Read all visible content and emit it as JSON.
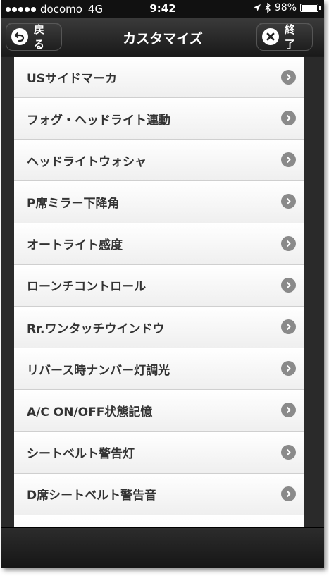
{
  "status_bar": {
    "carrier": "docomo",
    "network": "4G",
    "time": "9:42",
    "battery": "98%",
    "battery_level": 0.98
  },
  "nav": {
    "title": "カスタマイズ",
    "back_label": "戻る",
    "done_label": "終了"
  },
  "list": {
    "items": [
      {
        "label": "USサイドマーカ"
      },
      {
        "label": "フォグ・ヘッドライト連動"
      },
      {
        "label": "ヘッドライトウォシャ"
      },
      {
        "label": "P席ミラー下降角"
      },
      {
        "label": "オートライト感度"
      },
      {
        "label": "ローンチコントロール"
      },
      {
        "label": "Rr.ワンタッチウインドウ"
      },
      {
        "label": "リバース時ナンバー灯調光"
      },
      {
        "label": "A/C ON/OFF状態記憶"
      },
      {
        "label": "シートベルト警告灯"
      },
      {
        "label": "D席シートベルト警告音"
      },
      {
        "label": ""
      }
    ]
  },
  "colors": {
    "bar_dark": "#1a1a1a",
    "list_bg": "#f4f4f4",
    "text": "#333333",
    "chevron": "#8a8a8a"
  }
}
